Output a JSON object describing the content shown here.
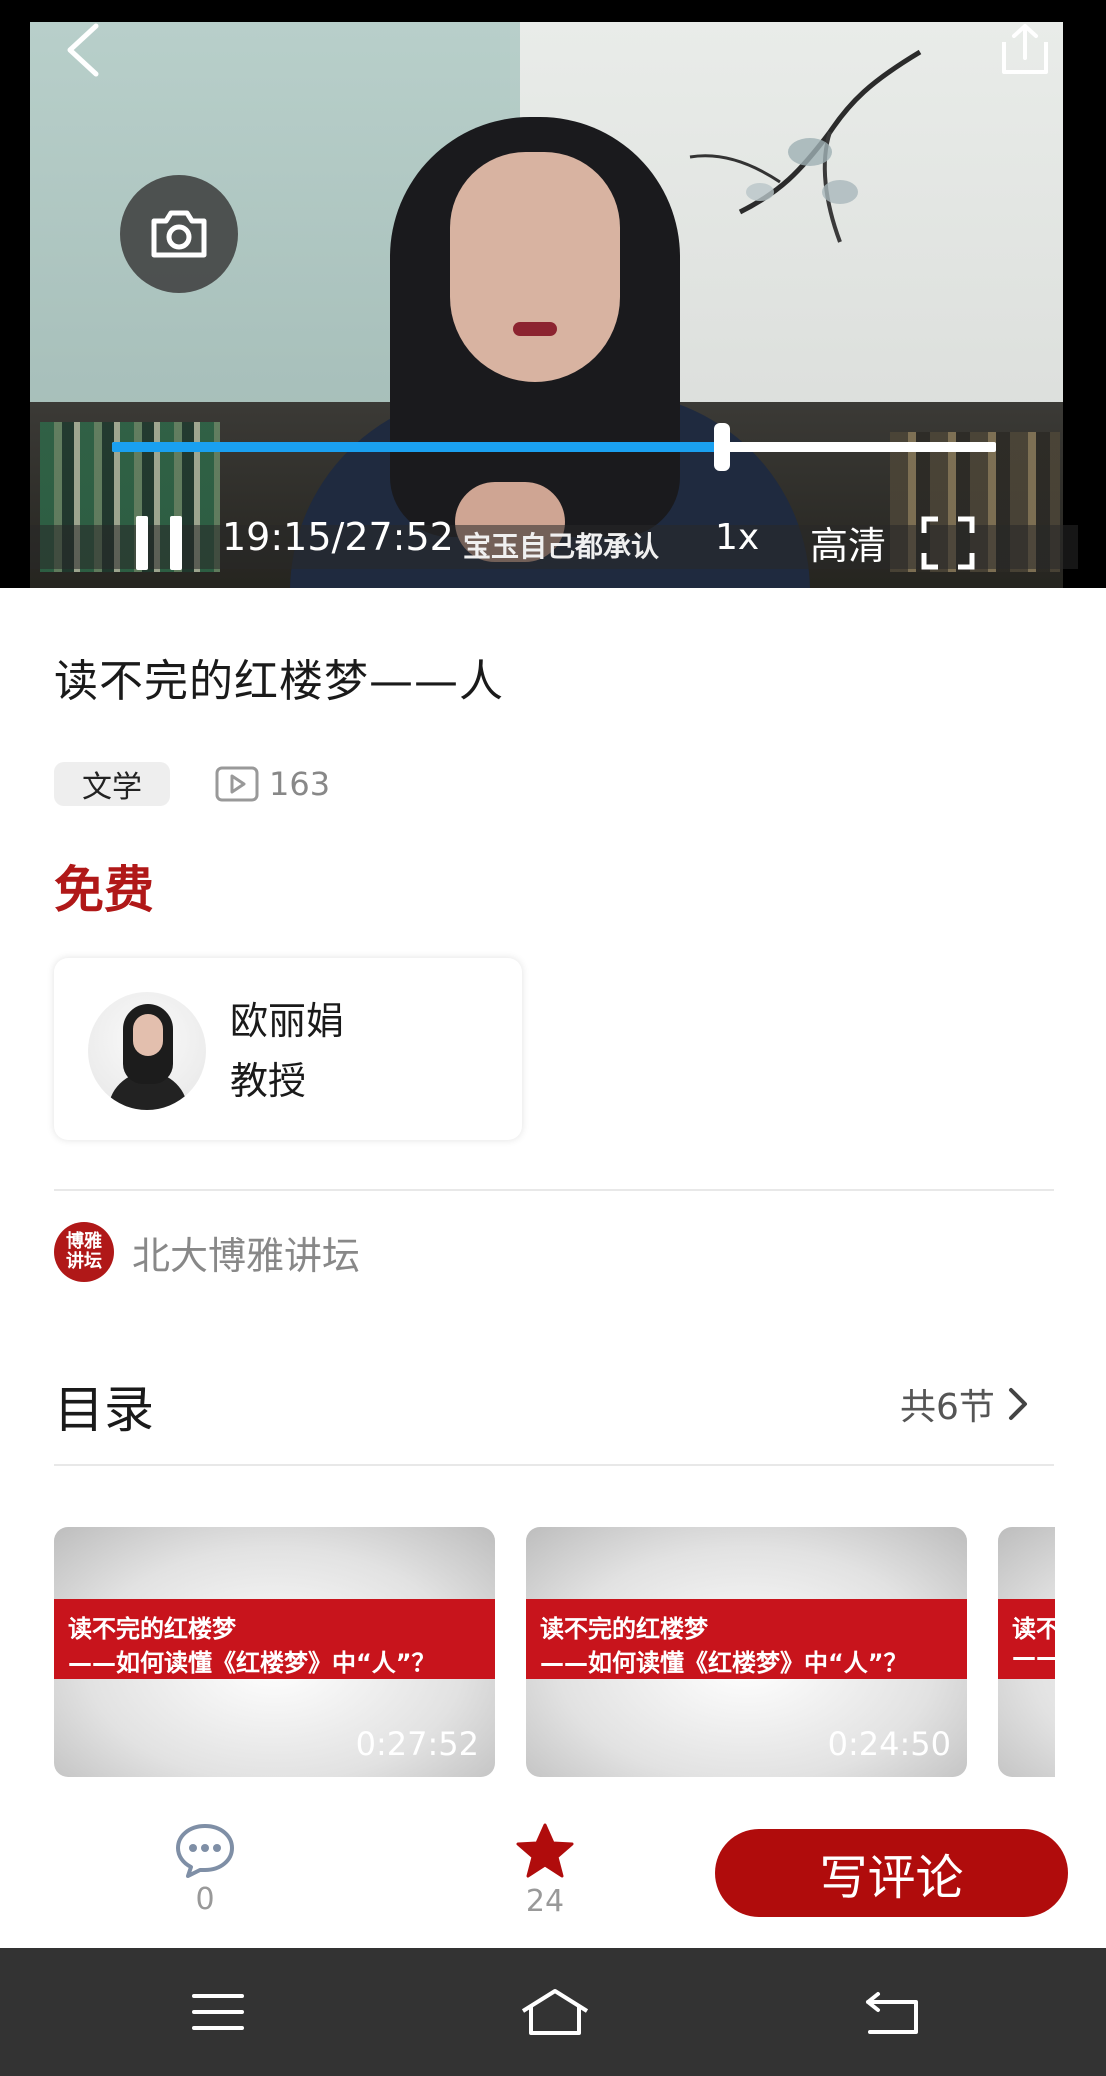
{
  "player": {
    "time": "19:15/27:52",
    "subtitle": "宝玉自己都承认",
    "speed": "1x",
    "quality": "高清",
    "progress_fraction": 0.69,
    "icons": [
      "back-icon",
      "share-icon",
      "camera-icon",
      "pause-icon",
      "fullscreen-icon"
    ]
  },
  "course": {
    "title": "读不完的红楼梦——人",
    "tag": "文学",
    "views": "163",
    "price": "免费"
  },
  "teacher": {
    "name": "欧丽娟",
    "role": "教授"
  },
  "org": {
    "logo_text": "博雅讲坛",
    "name": "北大博雅讲坛"
  },
  "catalog": {
    "title": "目录",
    "count": "共6节",
    "episodes": [
      {
        "line1": "读不完的红楼梦",
        "line2": "——如何读懂《红楼梦》中“人”？",
        "duration": "0:27:52"
      },
      {
        "line1": "读不完的红楼梦",
        "line2": "——如何读懂《红楼梦》中“人”？",
        "duration": "0:24:50"
      },
      {
        "line1": "读不",
        "line2": "——",
        "duration": ""
      }
    ]
  },
  "actions": {
    "comment_count": "0",
    "favorite_count": "24",
    "write_label": "写评论"
  },
  "colors": {
    "brand_red": "#b00c0c",
    "progress_blue": "#1aa0f0",
    "price_red": "#b01818"
  }
}
